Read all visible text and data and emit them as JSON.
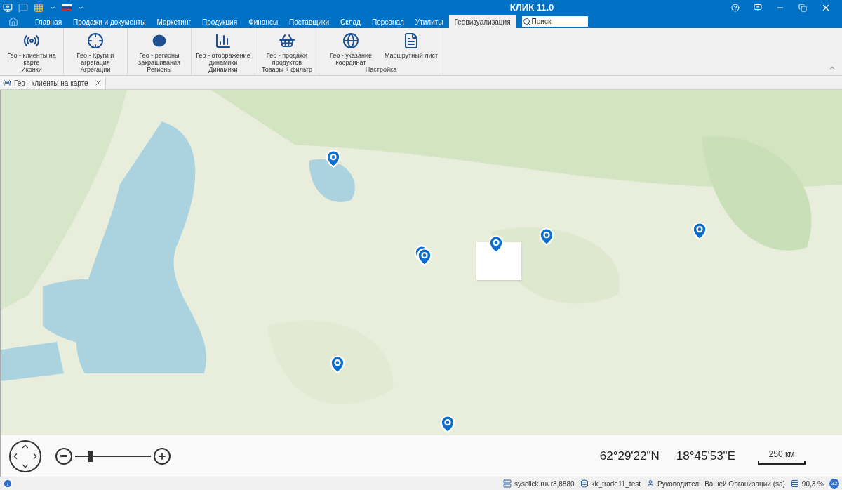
{
  "window": {
    "title": "КЛИК 11.0"
  },
  "menu_tabs": [
    {
      "label": "Главная",
      "selected": false
    },
    {
      "label": "Продажи и документы",
      "selected": false
    },
    {
      "label": "Маркетинг",
      "selected": false
    },
    {
      "label": "Продукция",
      "selected": false
    },
    {
      "label": "Финансы",
      "selected": false
    },
    {
      "label": "Поставщики",
      "selected": false
    },
    {
      "label": "Склад",
      "selected": false
    },
    {
      "label": "Персонал",
      "selected": false
    },
    {
      "label": "Утилиты",
      "selected": false
    },
    {
      "label": "Геовизуализация",
      "selected": true
    }
  ],
  "search": {
    "placeholder": "Поиск"
  },
  "ribbon_groups": [
    {
      "label": "Иконки",
      "buttons": [
        {
          "label": "Гео - клиенты на карте",
          "kind": "signal"
        }
      ]
    },
    {
      "label": "Агрегации",
      "buttons": [
        {
          "label": "Гео - Круги и агрегация",
          "kind": "target"
        }
      ]
    },
    {
      "label": "Регионы",
      "buttons": [
        {
          "label": "Гео - регионы закрашивания",
          "kind": "circle"
        }
      ]
    },
    {
      "label": "Динамики",
      "buttons": [
        {
          "label": "Гео - отображение динамики",
          "kind": "bars"
        }
      ]
    },
    {
      "label": "Товары + фильтр",
      "buttons": [
        {
          "label": "Гео - продажи продуктов",
          "kind": "basket"
        }
      ]
    },
    {
      "label": "Настройка",
      "buttons": [
        {
          "label": "Гео - указание координат",
          "kind": "globe"
        },
        {
          "label": "Маршрутный лист",
          "kind": "document"
        }
      ]
    }
  ],
  "document_tab": {
    "label": "Гео - клиенты на карте"
  },
  "map_controls": {
    "zoom": {
      "level": 0.2
    },
    "latitude": "62°29'22\"N",
    "longitude": "18°45'53\"E",
    "scale": "250 км"
  },
  "status_bar": {
    "server": "sysclick.ru\\ r3,8880",
    "database": "kk_trade11_test",
    "user": "Руководитель Вашей Организации (sa)",
    "zoom": "90,3 %",
    "badge": "32"
  }
}
